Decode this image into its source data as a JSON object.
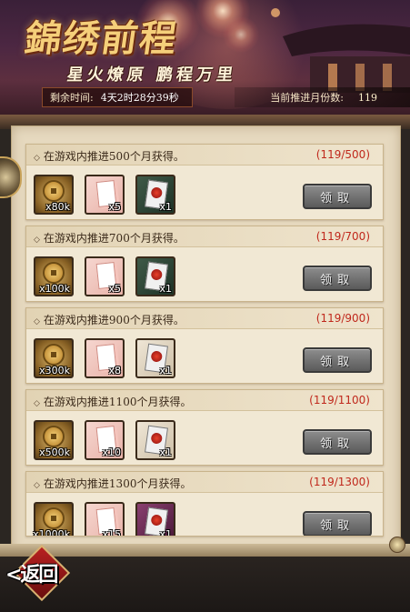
{
  "banner": {
    "title": "錦绣前程",
    "subtitle": "星火燎原  鹏程万里",
    "timer_label": "剩余时间:",
    "timer_value": "4天2时28分39秒",
    "months_label": "当前推进月份数:",
    "months_value": "119"
  },
  "tasks": [
    {
      "title": "在游戏内推进500个月获得。",
      "progress": "(119/500)",
      "rewards": [
        {
          "icon": "copper-coin-icon",
          "count": "x80k"
        },
        {
          "icon": "pink-card-icon",
          "count": "x5"
        },
        {
          "icon": "red-flower-card-icon",
          "count": "x1"
        }
      ],
      "button": "领取"
    },
    {
      "title": "在游戏内推进700个月获得。",
      "progress": "(119/700)",
      "rewards": [
        {
          "icon": "copper-coin-icon",
          "count": "x100k"
        },
        {
          "icon": "pink-card-icon",
          "count": "x5"
        },
        {
          "icon": "red-flower-card-icon",
          "count": "x1"
        }
      ],
      "button": "领取"
    },
    {
      "title": "在游戏内推进900个月获得。",
      "progress": "(119/900)",
      "rewards": [
        {
          "icon": "copper-coin-icon",
          "count": "x300k"
        },
        {
          "icon": "pink-card-icon",
          "count": "x8"
        },
        {
          "icon": "red-flower-card-icon",
          "count": "x1"
        }
      ],
      "button": "领取"
    },
    {
      "title": "在游戏内推进1100个月获得。",
      "progress": "(119/1100)",
      "rewards": [
        {
          "icon": "copper-coin-icon",
          "count": "x500k"
        },
        {
          "icon": "pink-card-icon",
          "count": "x10"
        },
        {
          "icon": "red-flower-card-icon",
          "count": "x1"
        }
      ],
      "button": "领取"
    },
    {
      "title": "在游戏内推进1300个月获得。",
      "progress": "(119/1300)",
      "rewards": [
        {
          "icon": "copper-coin-icon",
          "count": "x1000k"
        },
        {
          "icon": "pink-card-icon",
          "count": "x15"
        },
        {
          "icon": "purple-box-card-icon",
          "count": "x1"
        }
      ],
      "button": "领取"
    }
  ],
  "footer": {
    "back_label": "<返回"
  },
  "colors": {
    "progress_text": "#c0281c",
    "button_disabled": "#6e6e6e",
    "panel_bg": "#e6d9bf"
  }
}
